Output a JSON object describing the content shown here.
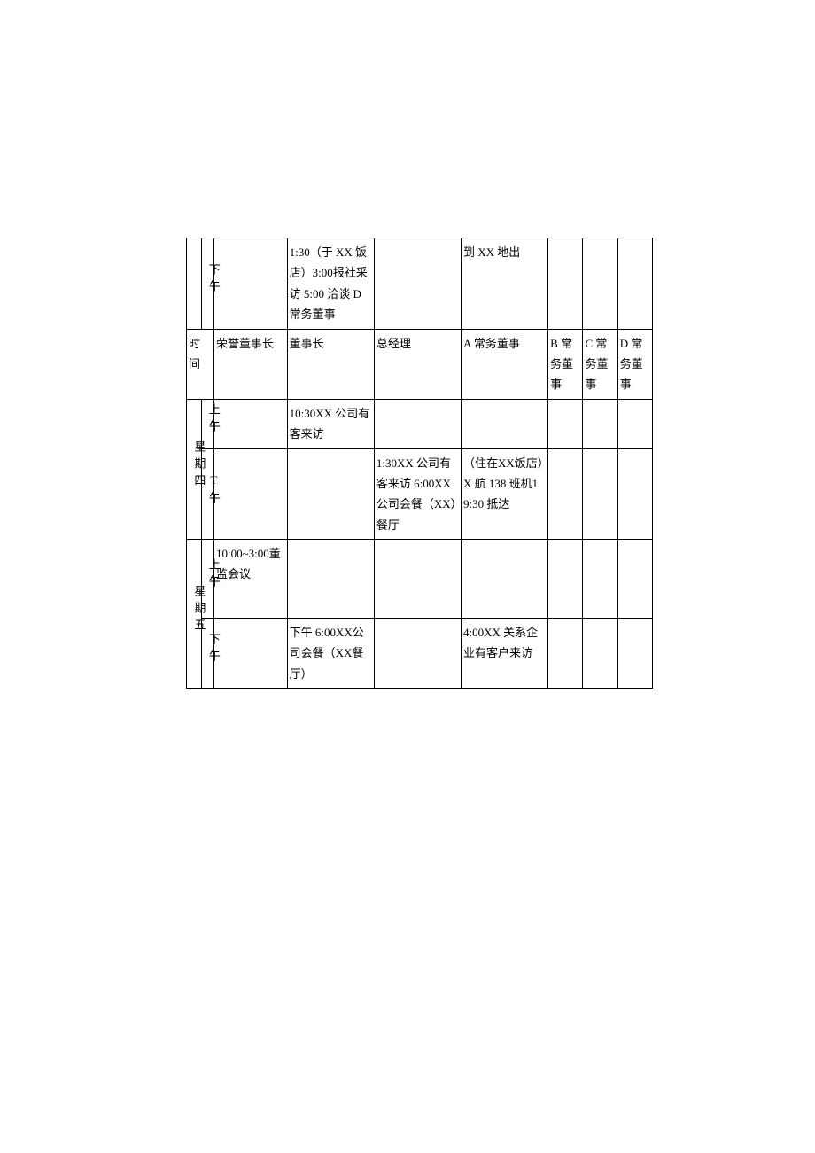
{
  "headers": {
    "time": "时间",
    "honorary_chairman": "荣誉董事长",
    "chairman": "董事长",
    "general_manager": "总经理",
    "a_director": "A 常务董事",
    "b_director": "B 常务董事",
    "c_director": "C 常务董事",
    "d_director": "D 常务董事"
  },
  "days": {
    "thursday": "星期四",
    "friday": "星期五"
  },
  "periods": {
    "am": "上午",
    "pm": "下午",
    "t_pm": "T午"
  },
  "cells": {
    "row1_chairman": "1:30（于 XX 饭店）3:00报社采访 5:00 洽谈 D常务董事",
    "row1_a": "到 XX 地出",
    "thu_am_chairman": "10:30XX 公司有客来访",
    "thu_pm_gm": "1:30XX 公司有客来访 6:00XX 公司会餐（XX）餐厅",
    "thu_pm_a": "（住在XX饭店）X 航 138 班机19:30 抵达",
    "fri_am_honorary": "10:00~3:00董监会议",
    "fri_pm_chairman": "下午 6:00XX公司会餐（XX餐厅）",
    "fri_pm_a": "4:00XX 关系企业有客户来访"
  }
}
